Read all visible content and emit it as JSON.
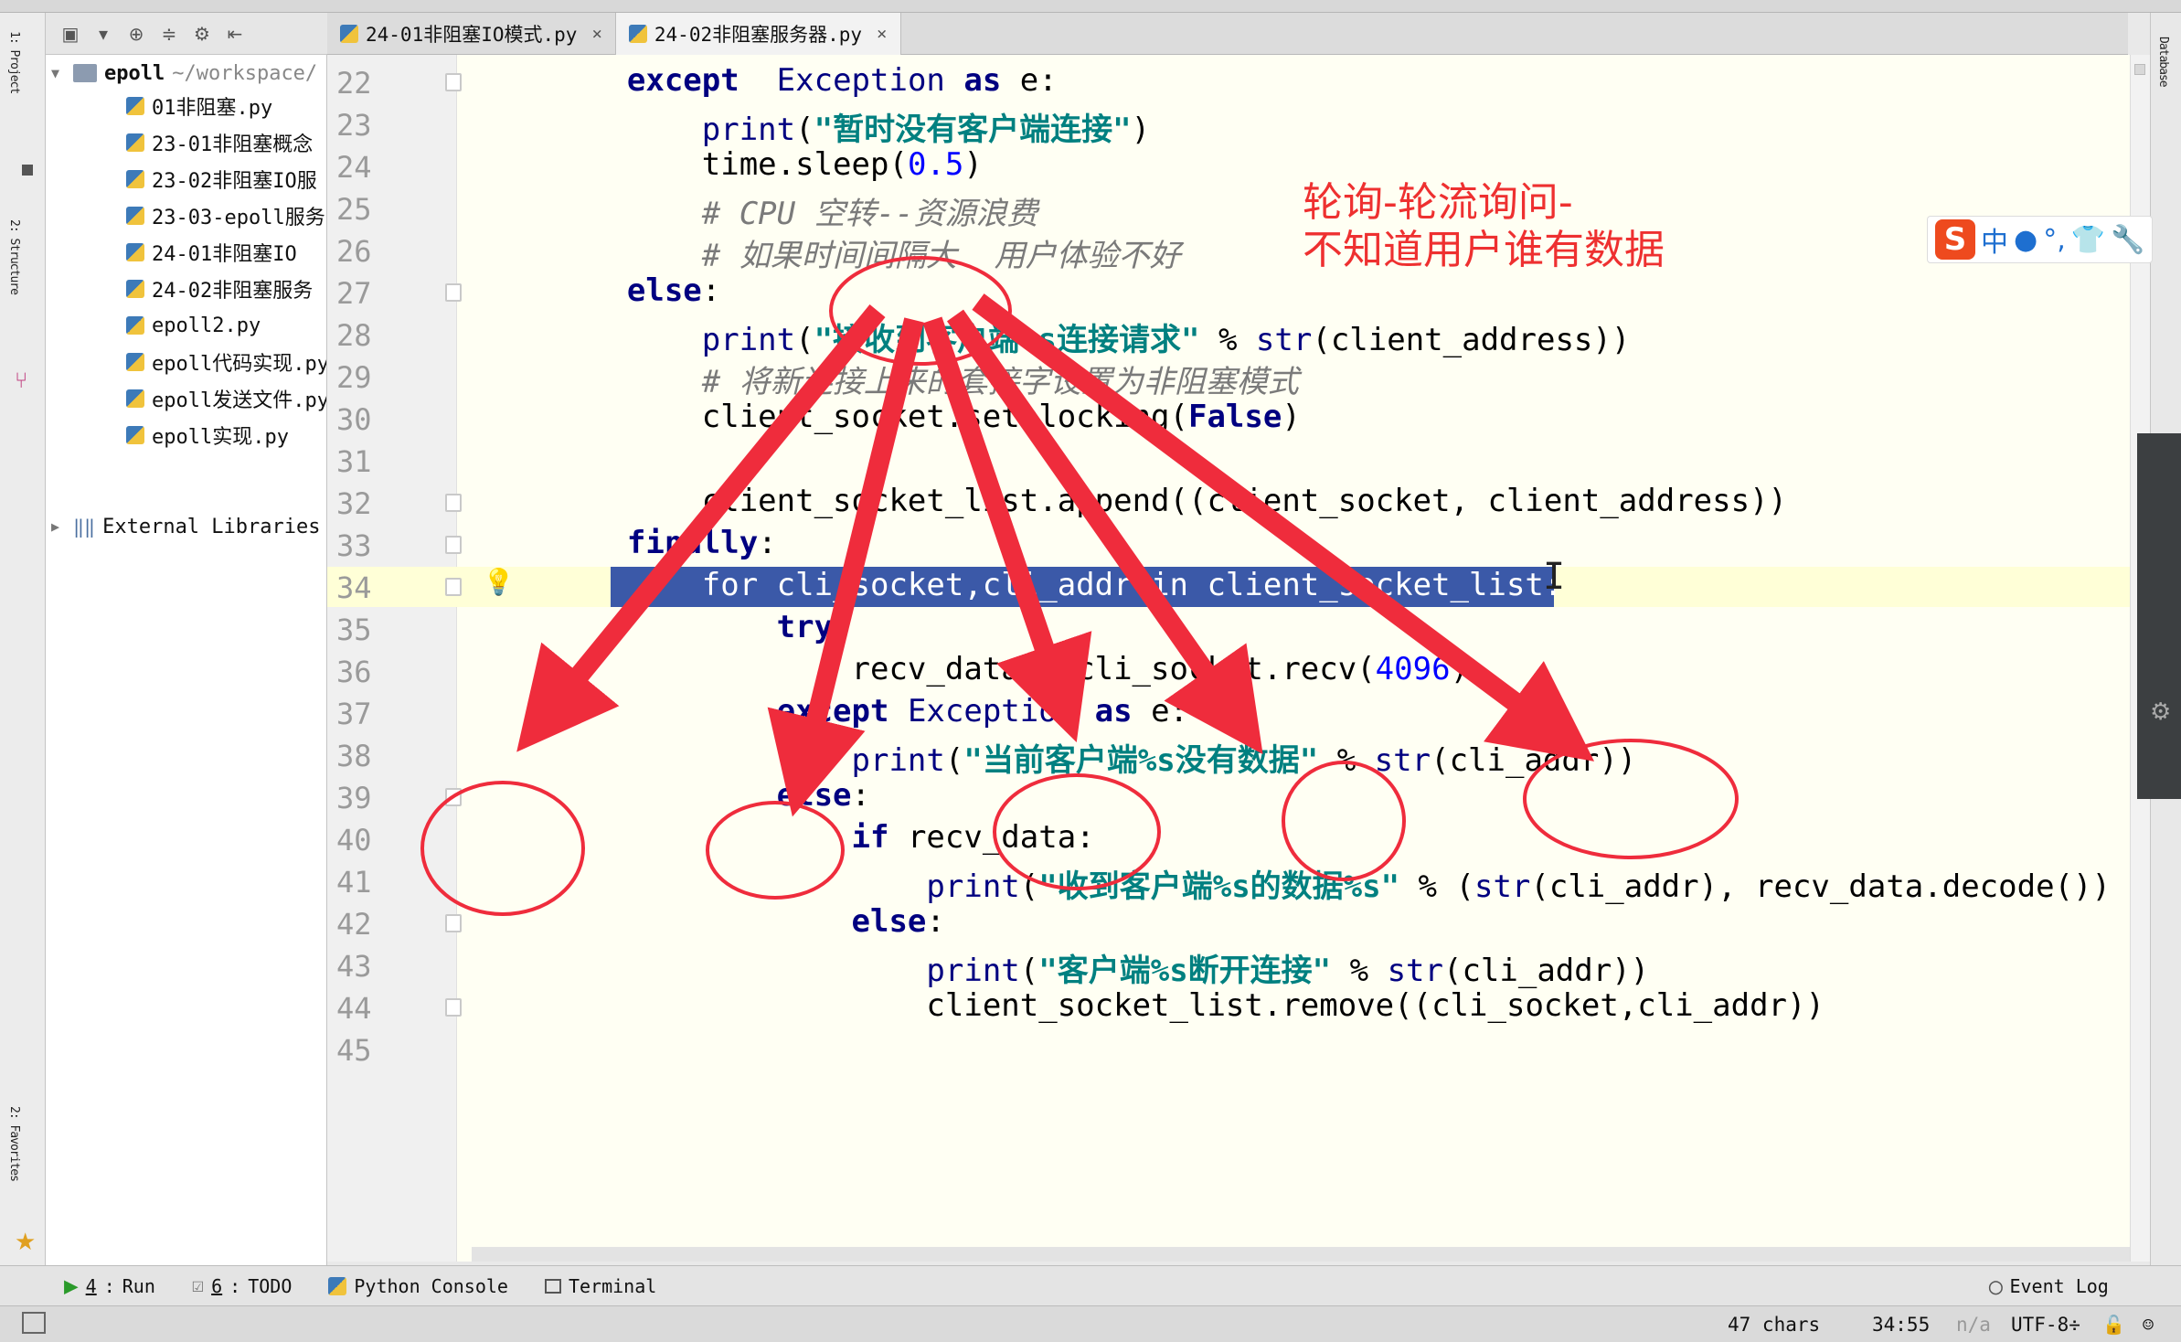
{
  "tabs": [
    {
      "label": "24-01非阻塞IO模式.py",
      "close": "×"
    },
    {
      "label": "24-02非阻塞服务器.py",
      "close": "×"
    }
  ],
  "left_strip": {
    "label_top": "1: Project",
    "label_mid": "2: Structure",
    "label_bottom": "2: Favorites"
  },
  "right_strip": {
    "label": "Database"
  },
  "project": {
    "root_name": "epoll",
    "root_path": "~/workspace/",
    "files": [
      "01非阻塞.py",
      "23-01非阻塞概念",
      "23-02非阻塞IO服",
      "23-03-epoll服务",
      "24-01非阻塞IO",
      "24-02非阻塞服务",
      "epoll2.py",
      "epoll代码实现.py",
      "epoll发送文件.py",
      "epoll实现.py"
    ],
    "external": "External Libraries"
  },
  "editor": {
    "line_numbers": [
      "22",
      "23",
      "24",
      "25",
      "26",
      "27",
      "28",
      "29",
      "30",
      "31",
      "32",
      "33",
      "34",
      "35",
      "36",
      "37",
      "38",
      "39",
      "40",
      "41",
      "42",
      "43",
      "44",
      "45"
    ],
    "lines": [
      {
        "indent": "    ",
        "parts": [
          [
            "kw",
            "except"
          ],
          [
            "",
            "  "
          ],
          [
            "fn",
            "Exception"
          ],
          [
            "",
            ""
          ],
          [
            "kw",
            " as"
          ],
          [
            "",
            " e:"
          ]
        ]
      },
      {
        "indent": "        ",
        "parts": [
          [
            "fn",
            "print"
          ],
          [
            "",
            "("
          ],
          [
            "str",
            "\"暂时没有客户端连接\""
          ],
          [
            "",
            ")"
          ]
        ]
      },
      {
        "indent": "        ",
        "parts": [
          [
            "",
            "time.sleep("
          ],
          [
            "num",
            "0.5"
          ],
          [
            "",
            ")"
          ]
        ]
      },
      {
        "indent": "        ",
        "parts": [
          [
            "cmt",
            "# CPU 空转--资源浪费"
          ]
        ]
      },
      {
        "indent": "        ",
        "parts": [
          [
            "cmt",
            "# 如果时间间隔大  用户体验不好"
          ]
        ]
      },
      {
        "indent": "    ",
        "parts": [
          [
            "kw",
            "else"
          ],
          [
            "",
            ":"
          ]
        ]
      },
      {
        "indent": "        ",
        "parts": [
          [
            "fn",
            "print"
          ],
          [
            "",
            "("
          ],
          [
            "str",
            "\"接收到客户端%s连接请求\""
          ],
          [
            "",
            " % "
          ],
          [
            "fn",
            "str"
          ],
          [
            "",
            "(client_address))"
          ]
        ]
      },
      {
        "indent": "        ",
        "parts": [
          [
            "cmt",
            "# 将新连接上来的套接字设置为非阻塞模式"
          ]
        ]
      },
      {
        "indent": "        ",
        "parts": [
          [
            "",
            "client_socket.setblocking("
          ],
          [
            "kw",
            "False"
          ],
          [
            "",
            ")"
          ]
        ]
      },
      {
        "indent": "",
        "parts": [
          [
            "",
            ""
          ]
        ]
      },
      {
        "indent": "        ",
        "parts": [
          [
            "",
            "client_socket_list.append((client_socket, client_address))"
          ]
        ]
      },
      {
        "indent": "    ",
        "parts": [
          [
            "kw",
            "finally"
          ],
          [
            "",
            ":"
          ]
        ]
      },
      {
        "indent": "        ",
        "parts": [
          [
            "",
            "for cli_socket,cli_addr in client_socket_list:"
          ]
        ]
      },
      {
        "indent": "            ",
        "parts": [
          [
            "kw",
            "try"
          ],
          [
            "",
            ":"
          ]
        ]
      },
      {
        "indent": "                ",
        "parts": [
          [
            "",
            "recv_data = cli_socket.recv("
          ],
          [
            "num",
            "4096"
          ],
          [
            "",
            ")"
          ]
        ]
      },
      {
        "indent": "            ",
        "parts": [
          [
            "kw",
            "except"
          ],
          [
            "",
            " "
          ],
          [
            "fn",
            "Exception"
          ],
          [
            "kw",
            " as"
          ],
          [
            "",
            " e:"
          ]
        ]
      },
      {
        "indent": "                ",
        "parts": [
          [
            "fn",
            "print"
          ],
          [
            "",
            "("
          ],
          [
            "str",
            "\"当前客户端%s没有数据\""
          ],
          [
            "",
            " % "
          ],
          [
            "fn",
            "str"
          ],
          [
            "",
            "(cli_addr))"
          ]
        ]
      },
      {
        "indent": "            ",
        "parts": [
          [
            "kw",
            "else"
          ],
          [
            "",
            ":"
          ]
        ]
      },
      {
        "indent": "                ",
        "parts": [
          [
            "kw",
            "if"
          ],
          [
            "",
            " recv_data:"
          ]
        ]
      },
      {
        "indent": "                    ",
        "parts": [
          [
            "fn",
            "print"
          ],
          [
            "",
            "("
          ],
          [
            "str",
            "\"收到客户端%s的数据%s\""
          ],
          [
            "",
            " % ("
          ],
          [
            "fn",
            "str"
          ],
          [
            "",
            "(cli_addr), recv_data.decode())"
          ]
        ]
      },
      {
        "indent": "                ",
        "parts": [
          [
            "kw",
            "else"
          ],
          [
            "",
            ":"
          ]
        ]
      },
      {
        "indent": "                    ",
        "parts": [
          [
            "fn",
            "print"
          ],
          [
            "",
            "("
          ],
          [
            "str",
            "\"客户端%s断开连接\""
          ],
          [
            "",
            " % "
          ],
          [
            "fn",
            "str"
          ],
          [
            "",
            "(cli_addr))"
          ]
        ]
      },
      {
        "indent": "                    ",
        "parts": [
          [
            "",
            "client_socket_list.remove((cli_socket,cli_addr))"
          ]
        ]
      },
      {
        "indent": "",
        "parts": [
          [
            "",
            ""
          ]
        ]
      }
    ],
    "selected_line_index": 12
  },
  "annotation": {
    "line1": "轮询-轮流询问-",
    "line2": "不知道用户谁有数据",
    "color": "#ee3030"
  },
  "ime": {
    "logo": "S",
    "items": [
      "中",
      "●",
      "°,",
      "👕",
      "🔧"
    ]
  },
  "bottom_tools": [
    {
      "num": "4",
      "label": "Run"
    },
    {
      "num": "6",
      "label": "TODO"
    },
    {
      "num": "",
      "label": "Python Console"
    },
    {
      "num": "",
      "label": "Terminal"
    }
  ],
  "event_log": "Event Log",
  "status": {
    "chars": "47 chars",
    "position": "34:55",
    "na": "n/a",
    "encoding": "UTF-8÷"
  }
}
